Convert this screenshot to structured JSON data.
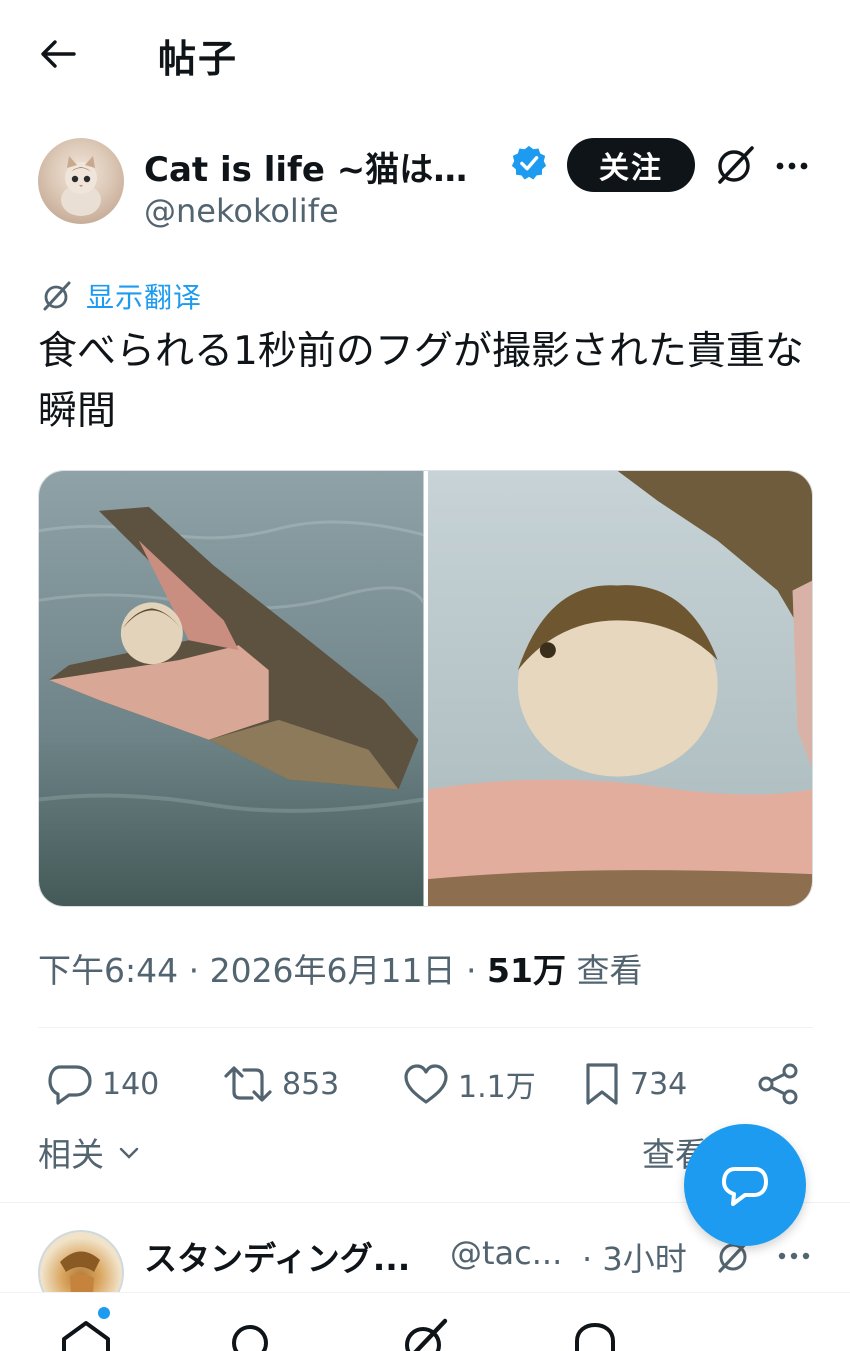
{
  "header": {
    "title": "帖子"
  },
  "author": {
    "name": "Cat is life ~猫は人...",
    "handle": "@nekokolife",
    "follow_label": "关注"
  },
  "translate_label": "显示翻译",
  "post": {
    "text": "食べられる1秒前のフグが撮影された貴重な瞬間"
  },
  "meta": {
    "time_date": "下午6:44 · 2026年6月11日 · ",
    "views_count": "51万",
    "views_label": "查看"
  },
  "actions": {
    "replies": "140",
    "reposts": "853",
    "likes": "1.1万",
    "bookmarks": "734"
  },
  "related": {
    "label": "相关",
    "view_label": "查看"
  },
  "reply": {
    "name": "スタンディング...",
    "handle": "@tac...",
    "time": "· 3小时"
  },
  "colors": {
    "accent": "#1d9bf0",
    "text": "#0f1419",
    "secondary": "#536471",
    "follow_bg": "#0f1419"
  },
  "icons": {
    "back": "arrow-left-icon",
    "verified": "verified-badge-icon",
    "grok": "grok-icon",
    "more": "more-dots-icon",
    "reply": "reply-bubble-icon",
    "repost": "repost-icon",
    "like": "heart-icon",
    "bookmark": "bookmark-icon",
    "share": "share-icon",
    "compose": "compose-message-icon"
  }
}
